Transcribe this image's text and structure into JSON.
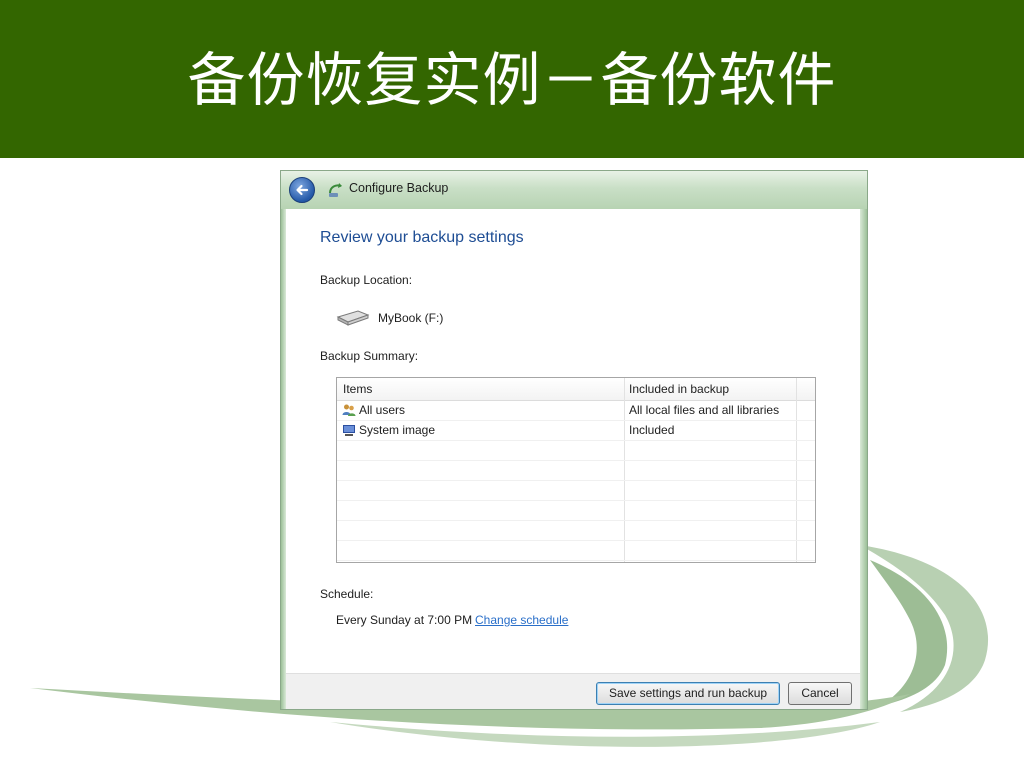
{
  "slide": {
    "title": "备份恢复实例－备份软件",
    "header_color": "#336600"
  },
  "window": {
    "title": "Configure Backup",
    "back_icon": "back-arrow-icon",
    "app_icon": "backup-icon"
  },
  "content": {
    "heading": "Review your backup settings",
    "location_label": "Backup Location:",
    "drive_name": "MyBook (F:)",
    "summary_label": "Backup Summary:",
    "table": {
      "headers": [
        "Items",
        "Included in backup"
      ],
      "rows": [
        {
          "icon": "users-icon",
          "item": "All users",
          "included": "All local files and all libraries"
        },
        {
          "icon": "system-image-icon",
          "item": "System image",
          "included": "Included"
        }
      ]
    },
    "schedule_label": "Schedule:",
    "schedule_text": "Every Sunday at 7:00 PM",
    "change_schedule_link": "Change schedule"
  },
  "footer": {
    "save_label": "Save settings and run backup",
    "cancel_label": "Cancel"
  },
  "colors": {
    "heading": "#1e4d94",
    "link": "#2a6fc9",
    "deco_green": "#a9c6a0"
  }
}
